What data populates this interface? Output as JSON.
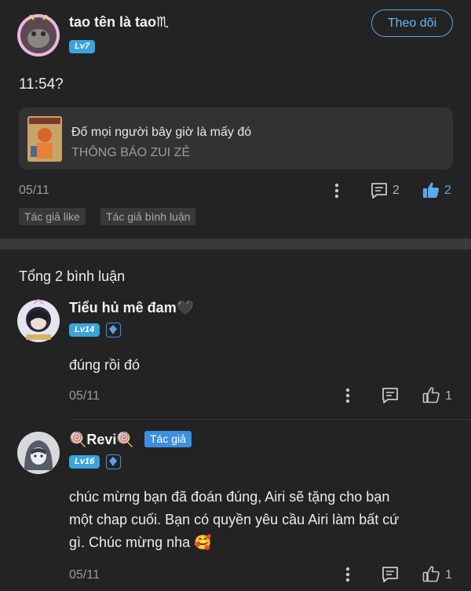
{
  "post": {
    "author": {
      "name": "tao tên là tao♏",
      "level": "Lv7"
    },
    "follow_label": "Theo dõi",
    "text": "11:54?",
    "quote": {
      "title": "Đố mọi người bây giờ là mấy đó",
      "subtitle": "THÔNG BÁO ZUI ZẺ"
    },
    "date": "05/11",
    "comment_count": "2",
    "like_count": "2",
    "tags": [
      "Tác giả like",
      "Tác giả bình luận"
    ]
  },
  "comments_section": {
    "title": "Tổng 2 bình luận",
    "comments": [
      {
        "name": "Tiểu hủ mê đam🖤",
        "level": "Lv14",
        "text": "đúng rồi đó",
        "date": "05/11",
        "like_count": "1"
      },
      {
        "name": "🍭Revi🍭",
        "author_tag": "Tác giả",
        "level": "Lv16",
        "text_lines": [
          "chúc mừng bạn đã đoán đúng, Airi sẽ tặng cho bạn",
          "một chap cuối. Bạn có quyền yêu cầu Airi làm bất cứ",
          "gì. Chúc mừng nha 🥰"
        ],
        "date": "05/11",
        "like_count": "1"
      }
    ]
  },
  "colors": {
    "accent": "#56a6e8",
    "level_badge": "#3aa5d9",
    "background": "#232323",
    "card": "#323232"
  }
}
